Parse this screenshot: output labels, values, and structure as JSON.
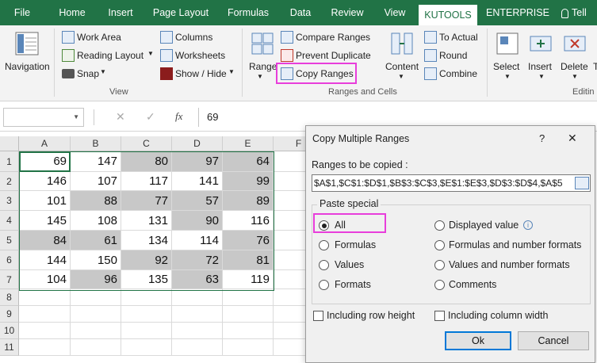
{
  "tabs": [
    {
      "label": "File"
    },
    {
      "label": "Home"
    },
    {
      "label": "Insert"
    },
    {
      "label": "Page Layout"
    },
    {
      "label": "Formulas"
    },
    {
      "label": "Data"
    },
    {
      "label": "Review"
    },
    {
      "label": "View"
    },
    {
      "label": "KUTOOLS"
    },
    {
      "label": "ENTERPRISE"
    },
    {
      "label": "Tell"
    }
  ],
  "active_tab": "KUTOOLS",
  "ribbon": {
    "navigation": "Navigation",
    "view_group": {
      "work_area": "Work Area",
      "reading_layout": "Reading Layout",
      "snap": "Snap",
      "columns": "Columns",
      "worksheets": "Worksheets",
      "show_hide": "Show / Hide",
      "group_name": "View"
    },
    "ranges_group": {
      "range": "Range",
      "compare_ranges": "Compare Ranges",
      "prevent_duplicate": "Prevent Duplicate",
      "copy_ranges": "Copy Ranges",
      "content": "Content",
      "to_actual": "To Actual",
      "round": "Round",
      "combine": "Combine",
      "group_name": "Ranges and Cells"
    },
    "editing_group": {
      "select": "Select",
      "insert": "Insert",
      "delete": "Delete",
      "text": "Te",
      "group_name": "Editin"
    }
  },
  "formula_bar": {
    "name_box": "",
    "fx": "fx",
    "value": "69"
  },
  "sheet": {
    "columns": [
      "A",
      "B",
      "C",
      "D",
      "E",
      "F"
    ],
    "rows": [
      "1",
      "2",
      "3",
      "4",
      "5",
      "6",
      "7",
      "8",
      "9",
      "10",
      "11"
    ],
    "values": [
      [
        "69",
        "147",
        "80",
        "97",
        "64"
      ],
      [
        "146",
        "107",
        "117",
        "141",
        "99"
      ],
      [
        "101",
        "88",
        "77",
        "57",
        "89"
      ],
      [
        "145",
        "108",
        "131",
        "90",
        "116"
      ],
      [
        "84",
        "61",
        "134",
        "114",
        "76"
      ],
      [
        "144",
        "150",
        "92",
        "72",
        "81"
      ],
      [
        "104",
        "96",
        "135",
        "63",
        "119"
      ]
    ],
    "shaded": [
      [
        false,
        false,
        true,
        true,
        true
      ],
      [
        false,
        false,
        false,
        false,
        true
      ],
      [
        false,
        true,
        true,
        true,
        true
      ],
      [
        false,
        false,
        false,
        true,
        false
      ],
      [
        true,
        true,
        false,
        false,
        true
      ],
      [
        false,
        false,
        true,
        true,
        true
      ],
      [
        false,
        true,
        false,
        true,
        false
      ]
    ],
    "shade_color": "#c8c8c8"
  },
  "dialog": {
    "title": "Copy Multiple Ranges",
    "help": "?",
    "close": "✕",
    "ranges_label": "Ranges to be copied :",
    "ranges_value": "$A$1,$C$1:$D$1,$B$3:$C$3,$E$1:$E$3,$D$3:$D$4,$A$5",
    "paste_special_label": "Paste special",
    "options_left": [
      {
        "label": "All",
        "selected": true
      },
      {
        "label": "Formulas",
        "selected": false
      },
      {
        "label": "Values",
        "selected": false
      },
      {
        "label": "Formats",
        "selected": false
      }
    ],
    "options_right": [
      {
        "label": "Displayed value",
        "selected": false
      },
      {
        "label": "Formulas and number formats",
        "selected": false
      },
      {
        "label": "Values and number formats",
        "selected": false
      },
      {
        "label": "Comments",
        "selected": false
      }
    ],
    "info_icon": "i",
    "include_row_height": "Including row height",
    "include_col_width": "Including column width",
    "ok": "Ok",
    "cancel": "Cancel"
  },
  "colors": {
    "accent": "#217346",
    "highlight": "#e83edb",
    "selection_border": "#217346"
  }
}
